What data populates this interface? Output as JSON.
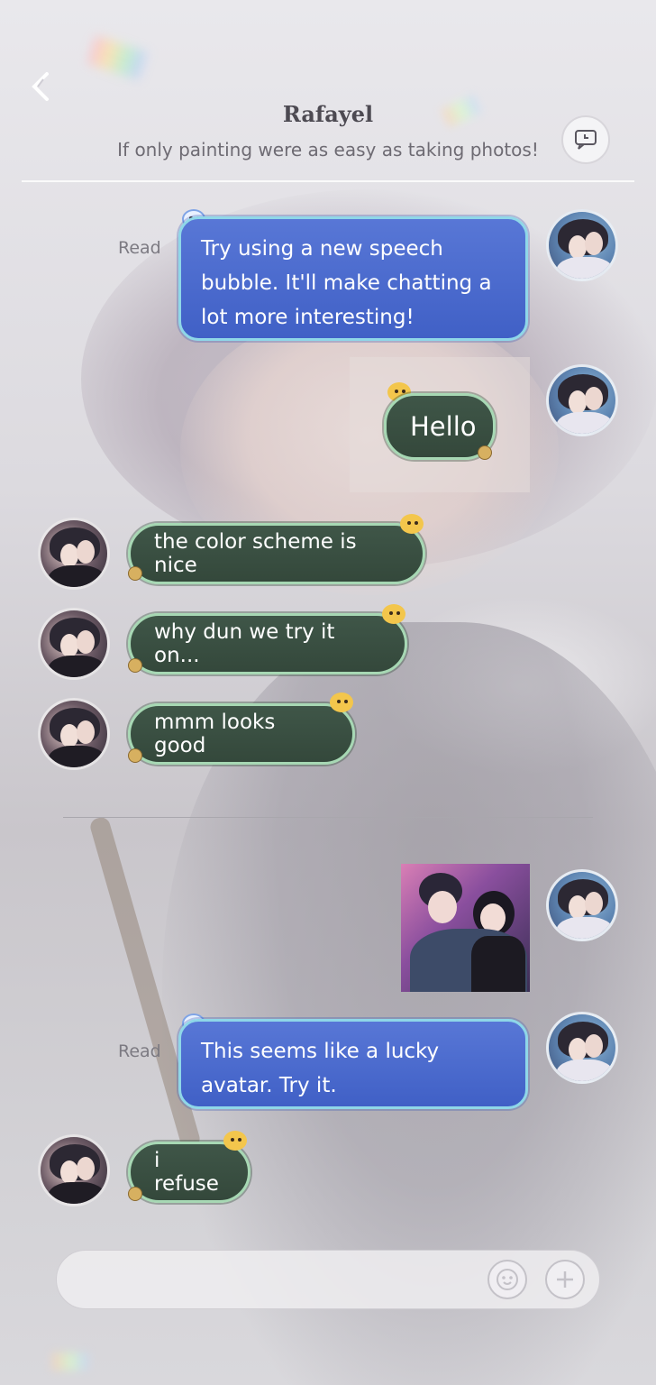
{
  "header": {
    "title": "Rafayel",
    "subtitle": "If only painting were as easy as taking photos!"
  },
  "messages": [
    {
      "sender": "me",
      "text": "Try using a new speech bubble. It'll make chatting a lot more interesting!",
      "status": "Read"
    },
    {
      "sender": "me",
      "text": "Hello"
    },
    {
      "sender": "her",
      "text": "the color scheme is nice"
    },
    {
      "sender": "her",
      "text": "why dun we try it on..."
    },
    {
      "sender": "her",
      "text": "mmm looks good"
    },
    {
      "sender": "me",
      "type": "image"
    },
    {
      "sender": "me",
      "text": "This seems like a lucky avatar. Try it.",
      "status": "Read"
    },
    {
      "sender": "her",
      "text": "i refuse"
    }
  ],
  "input": {
    "placeholder": ""
  },
  "colors": {
    "blue_bubble": "#4a6ccf",
    "green_bubble": "#3a4f42",
    "bubble_border_blue": "#8fd7e8",
    "bubble_border_green": "#a7d8b4"
  },
  "icons": {
    "back": "chevron-left-icon",
    "header_action": "chat-history-icon",
    "emoji": "emoji-icon",
    "plus": "plus-icon"
  }
}
